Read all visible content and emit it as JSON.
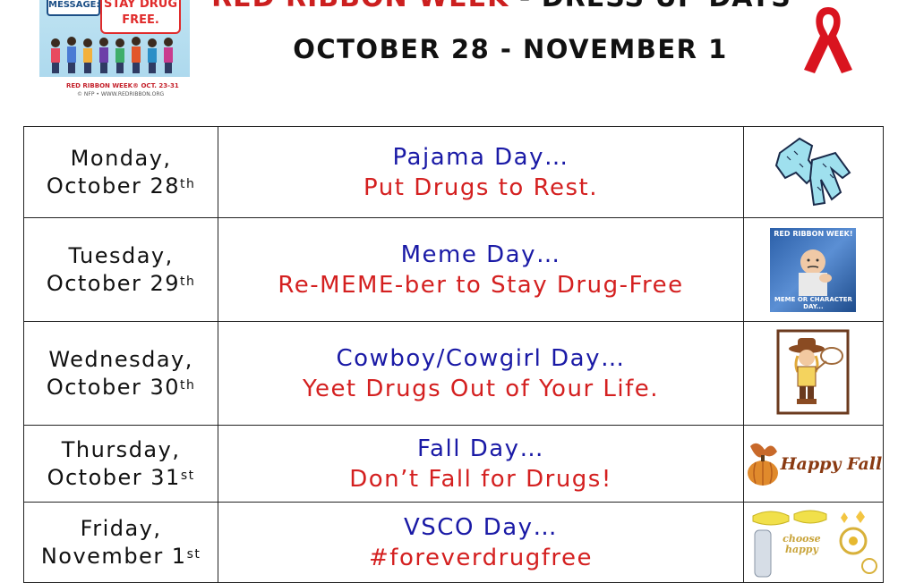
{
  "header": {
    "title_red": "RED RIBBON WEEK",
    "title_sep": " - ",
    "title_black": "DRESS UP DAYS",
    "dates": "OCTOBER 28 - NOVEMBER 1"
  },
  "poster": {
    "bubble_left": "MESSAGE:",
    "bubble_right_1": "STAY DRUG",
    "bubble_right_2": "FREE.",
    "band_text": "RED RIBBON WEEK® OCT. 23-31",
    "band_sub": "© NFP • WWW.REDRIBBON.ORG"
  },
  "colors": {
    "theme_blue": "#1a1aa6",
    "slogan_red": "#d42020",
    "ribbon_red": "#d9141f"
  },
  "schedule": [
    {
      "weekday": "Monday,",
      "date": "October 28",
      "suffix": "th",
      "theme": "Pajama Day…",
      "slogan": "Put Drugs to Rest.",
      "icon": "pajama-icon"
    },
    {
      "weekday": "Tuesday,",
      "date": "October 29",
      "suffix": "th",
      "theme": "Meme Day…",
      "slogan": "Re-MEME-ber to Stay Drug-Free",
      "icon": "meme-image",
      "meme_top": "RED RIBBON WEEK!",
      "meme_bottom": "MEME OR CHARACTER DAY..."
    },
    {
      "weekday": "Wednesday,",
      "date": "October 30",
      "suffix": "th",
      "theme": "Cowboy/Cowgirl Day…",
      "slogan": "Yeet Drugs Out of Your Life.",
      "icon": "cowboy-icon"
    },
    {
      "weekday": "Thursday,",
      "date": "October 31",
      "suffix": "st",
      "theme": "Fall Day…",
      "slogan": "Don’t Fall for Drugs!",
      "icon": "fall-icon",
      "fall_text": "Happy Fall"
    },
    {
      "weekday": "Friday,",
      "date": "November 1",
      "suffix": "st",
      "theme": "VSCO Day…",
      "slogan": "#foreverdrugfree",
      "icon": "vsco-icon",
      "vsco_words": "choose happy"
    }
  ]
}
